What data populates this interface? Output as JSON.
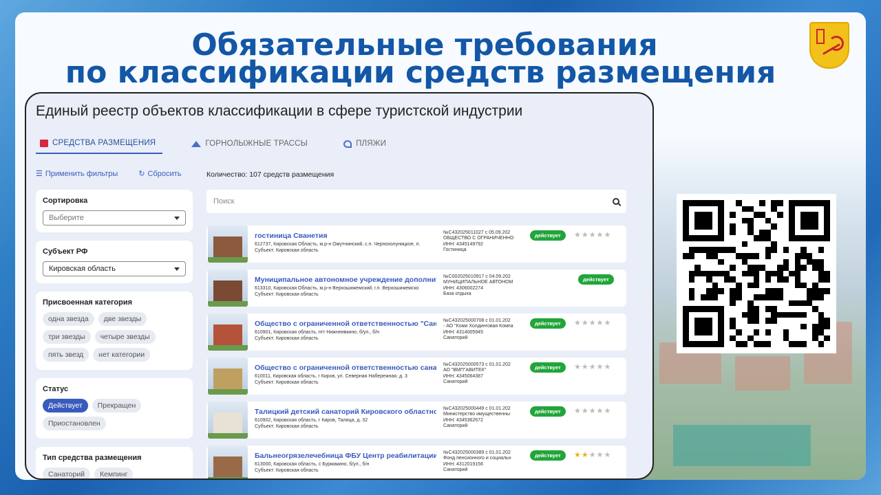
{
  "slide": {
    "title_line1": "Обязательные требования",
    "title_line2": "по классификации средств размещения"
  },
  "panel": {
    "title": "Единый реестр объектов классификации в сфере туристской индустрии",
    "tabs": [
      {
        "label": "СРЕДСТВА РАЗМЕЩЕНИЯ",
        "icon": "hotel-icon",
        "active": true
      },
      {
        "label": "ГОРНОЛЫЖНЫЕ ТРАССЫ",
        "icon": "mountain-icon",
        "active": false
      },
      {
        "label": "ПЛЯЖИ",
        "icon": "beach-icon",
        "active": false
      }
    ],
    "apply_filters": "Применить фильтры",
    "reset": "Сбросить",
    "count": "Количество: 107 средств размещения",
    "search_placeholder": "Поиск"
  },
  "filters": {
    "sort": {
      "label": "Сортировка",
      "value": "Выберите"
    },
    "subject": {
      "label": "Субъект РФ",
      "value": "Кировская область"
    },
    "category": {
      "label": "Присвоенная категория",
      "options": [
        "одна звезда",
        "две звезды",
        "три звезды",
        "четыре звезды",
        "пять звезд",
        "нет категории"
      ]
    },
    "status": {
      "label": "Статус",
      "options": [
        "Действует",
        "Прекращен",
        "Приостановлен"
      ],
      "selected": "Действует"
    },
    "type": {
      "label": "Тип средства размещения",
      "options": [
        "Санаторий",
        "Кемпинг"
      ]
    }
  },
  "results": [
    {
      "name": "гостиница Сванетия",
      "addr": "612737, Кировская Область, м.р-н Омутнинский, с.п. Чернохолуницкое, п.",
      "subject": "Субъект: Кировская область",
      "reg": "№С432025011027 с 05.09.202",
      "org": "ОБЩЕСТВО С ОГРАНИЧЕННО",
      "inn": "ИНН: 4345149792",
      "kind": "Гостиница",
      "status": "действует",
      "stars": 0,
      "show_stars": true
    },
    {
      "name": "Муниципальное автономное учреждение дополнит",
      "addr": "613310, Кировская Область, м.р-н Верхошижемский, г.п. Верхошижемско",
      "subject": "Субъект: Кировская область",
      "reg": "№С002025010917 с 04.09.202",
      "org": "МУНИЦИПАЛЬНОЕ АВТОНОМ",
      "inn": "ИНН: 4306002274",
      "kind": "База отдыха",
      "status": "действует",
      "stars": 0,
      "show_stars": false
    },
    {
      "name": "Общество с ограниченной ответственностью \"Сана",
      "addr": "610901, Кировская область, пгт Нижнеивкино, б/ул., б/н",
      "subject": "Субъект: Кировская область",
      "reg": "№С432025000708 с 01.01.202",
      "org": "- АО \"Коми Холдинговая Компа",
      "inn": "ИНН: 4314005945",
      "kind": "Санаторий",
      "status": "действует",
      "stars": 0,
      "show_stars": true
    },
    {
      "name": "Общество с ограниченной ответственностью санато",
      "addr": "610011, Кировская область, г Киров, ул. Северная Набережная, д. 3",
      "subject": "Субъект: Кировская область",
      "reg": "№С432025000573 с 01.01.202",
      "org": "АО \"ВМП\"АВИТЕК\"",
      "inn": "ИНН: 4345064387",
      "kind": "Санаторий",
      "status": "действует",
      "stars": 0,
      "show_stars": true
    },
    {
      "name": "Талицкий детский санаторий Кировского областно",
      "addr": "610902, Кировская область, г Киров, Талица, д. 32",
      "subject": "Субъект: Кировская область",
      "reg": "№С432025000449 с 01.01.202",
      "org": "Министерство имущественны",
      "inn": "ИНН: 4345362672",
      "kind": "Санаторий",
      "status": "действует",
      "stars": 0,
      "show_stars": true
    },
    {
      "name": "Бальнеогрязелечебница ФБУ Центр реабилитации",
      "addr": "613000, Кировская область, с Бурмакино, б/ул., б/н",
      "subject": "Субъект: Кировская область",
      "reg": "№С432025000389 с 01.01.202",
      "org": "Фонд пенсионного и социальн",
      "inn": "ИНН: 4312019156",
      "kind": "Санаторий",
      "status": "действует",
      "stars": 2,
      "show_stars": true
    }
  ],
  "colors": {
    "accent": "#3a5bbd",
    "status_green": "#22a53a",
    "title_blue": "#1357a6"
  }
}
